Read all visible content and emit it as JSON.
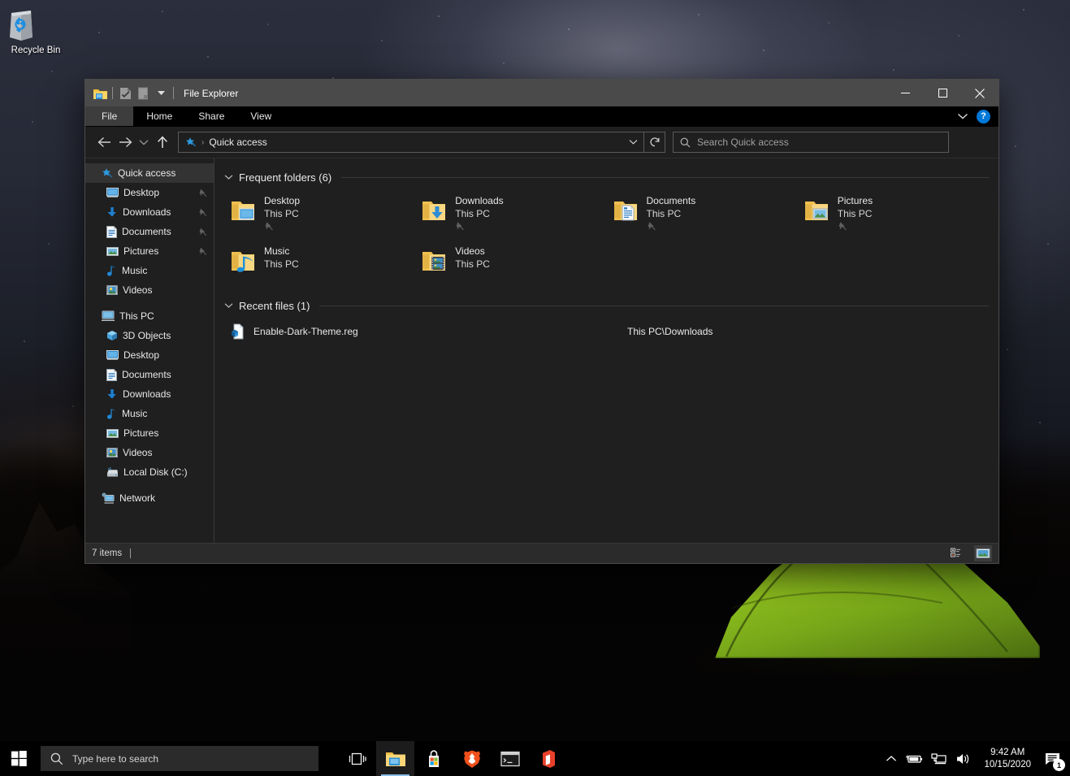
{
  "desktop": {
    "icons": [
      {
        "label": "Recycle Bin",
        "icon": "recycle-bin-icon"
      }
    ]
  },
  "window": {
    "title": "File Explorer",
    "quick_access_toolbar": [
      {
        "name": "folder-icon",
        "label": ""
      },
      {
        "name": "properties-icon",
        "label": ""
      },
      {
        "name": "new-folder-icon",
        "label": ""
      },
      {
        "name": "customize-dropdown-icon",
        "label": ""
      }
    ],
    "controls": {
      "minimize": "—",
      "maximize": "☐",
      "close": "✕"
    },
    "ribbon": {
      "tabs": [
        {
          "label": "File",
          "active": true
        },
        {
          "label": "Home",
          "active": false
        },
        {
          "label": "Share",
          "active": false
        },
        {
          "label": "View",
          "active": false
        }
      ],
      "collapse_icon": "chevron-down-icon",
      "help_label": "?"
    },
    "nav": {
      "back_icon": "arrow-left-icon",
      "forward_icon": "arrow-right-icon",
      "recent_icon": "chevron-down-icon",
      "up_icon": "arrow-up-icon",
      "breadcrumbs": [
        {
          "label": "Quick access",
          "icon": "star-pin-icon"
        }
      ],
      "address_dropdown_icon": "chevron-down-icon",
      "refresh_icon": "refresh-icon"
    },
    "search": {
      "placeholder": "Search Quick access",
      "value": "",
      "icon": "search-icon"
    }
  },
  "sidebar": {
    "items": [
      {
        "label": "Quick access",
        "icon": "star-pin-icon",
        "level": "root",
        "selected": true,
        "pinned": false
      },
      {
        "label": "Desktop",
        "icon": "desktop-icon",
        "level": "child",
        "selected": false,
        "pinned": true
      },
      {
        "label": "Downloads",
        "icon": "downloads-icon",
        "level": "child",
        "selected": false,
        "pinned": true
      },
      {
        "label": "Documents",
        "icon": "documents-icon",
        "level": "child",
        "selected": false,
        "pinned": true
      },
      {
        "label": "Pictures",
        "icon": "pictures-icon",
        "level": "child",
        "selected": false,
        "pinned": true
      },
      {
        "label": "Music",
        "icon": "music-icon",
        "level": "child",
        "selected": false,
        "pinned": false
      },
      {
        "label": "Videos",
        "icon": "videos-icon",
        "level": "child",
        "selected": false,
        "pinned": false
      },
      {
        "label": "This PC",
        "icon": "this-pc-icon",
        "level": "root",
        "selected": false,
        "pinned": false
      },
      {
        "label": "3D Objects",
        "icon": "3d-objects-icon",
        "level": "child",
        "selected": false,
        "pinned": false
      },
      {
        "label": "Desktop",
        "icon": "desktop-icon",
        "level": "child",
        "selected": false,
        "pinned": false
      },
      {
        "label": "Documents",
        "icon": "documents-icon",
        "level": "child",
        "selected": false,
        "pinned": false
      },
      {
        "label": "Downloads",
        "icon": "downloads-icon",
        "level": "child",
        "selected": false,
        "pinned": false
      },
      {
        "label": "Music",
        "icon": "music-icon",
        "level": "child",
        "selected": false,
        "pinned": false
      },
      {
        "label": "Pictures",
        "icon": "pictures-icon",
        "level": "child",
        "selected": false,
        "pinned": false
      },
      {
        "label": "Videos",
        "icon": "videos-icon",
        "level": "child",
        "selected": false,
        "pinned": false
      },
      {
        "label": "Local Disk (C:)",
        "icon": "local-disk-icon",
        "level": "child",
        "selected": false,
        "pinned": false
      },
      {
        "label": "Network",
        "icon": "network-icon",
        "level": "root",
        "selected": false,
        "pinned": false
      }
    ]
  },
  "main": {
    "groups": [
      {
        "title": "Frequent folders (6)",
        "expanded": true,
        "layout": "tiles",
        "items": [
          {
            "name": "Desktop",
            "location": "This PC",
            "icon": "folder-desktop-icon",
            "pinned": true
          },
          {
            "name": "Downloads",
            "location": "This PC",
            "icon": "folder-downloads-icon",
            "pinned": true
          },
          {
            "name": "Documents",
            "location": "This PC",
            "icon": "folder-documents-icon",
            "pinned": true
          },
          {
            "name": "Pictures",
            "location": "This PC",
            "icon": "folder-pictures-icon",
            "pinned": true
          },
          {
            "name": "Music",
            "location": "This PC",
            "icon": "folder-music-icon",
            "pinned": false
          },
          {
            "name": "Videos",
            "location": "This PC",
            "icon": "folder-videos-icon",
            "pinned": false
          }
        ]
      },
      {
        "title": "Recent files (1)",
        "expanded": true,
        "layout": "rows",
        "items": [
          {
            "name": "Enable-Dark-Theme.reg",
            "path": "This PC\\Downloads",
            "icon": "registry-file-icon"
          }
        ]
      }
    ]
  },
  "statusbar": {
    "item_count": "7 items",
    "views": [
      {
        "name": "details-view-button",
        "active": false
      },
      {
        "name": "large-icons-view-button",
        "active": true
      }
    ]
  },
  "taskbar": {
    "start_icon": "windows-logo-icon",
    "search": {
      "placeholder": "Type here to search",
      "value": "",
      "icon": "search-icon"
    },
    "task_view_icon": "task-view-icon",
    "apps": [
      {
        "name": "file-explorer-taskbar-button",
        "icon": "folder-icon",
        "running": true
      },
      {
        "name": "microsoft-store-taskbar-button",
        "icon": "store-icon",
        "running": false
      },
      {
        "name": "brave-browser-taskbar-button",
        "icon": "brave-lion-icon",
        "running": false
      },
      {
        "name": "terminal-taskbar-button",
        "icon": "terminal-icon",
        "running": false
      },
      {
        "name": "office-taskbar-button",
        "icon": "office-icon",
        "running": false
      }
    ],
    "tray": [
      {
        "name": "show-hidden-icons-button",
        "icon": "chevron-up-icon"
      },
      {
        "name": "battery-status-icon",
        "icon": "battery-icon"
      },
      {
        "name": "network-status-icon",
        "icon": "monitor-network-icon"
      },
      {
        "name": "volume-icon",
        "icon": "speaker-icon"
      }
    ],
    "clock": {
      "time": "9:42 AM",
      "date": "10/15/2020"
    },
    "action_center": {
      "icon": "notifications-icon",
      "badge": "1"
    }
  },
  "colors": {
    "window_chrome": "#4a4a4a",
    "window_body": "#1f1f1f",
    "ribbon": "#000000",
    "accent": "#0078d7",
    "taskbar": "#000000",
    "text": "#e8e8e8"
  }
}
